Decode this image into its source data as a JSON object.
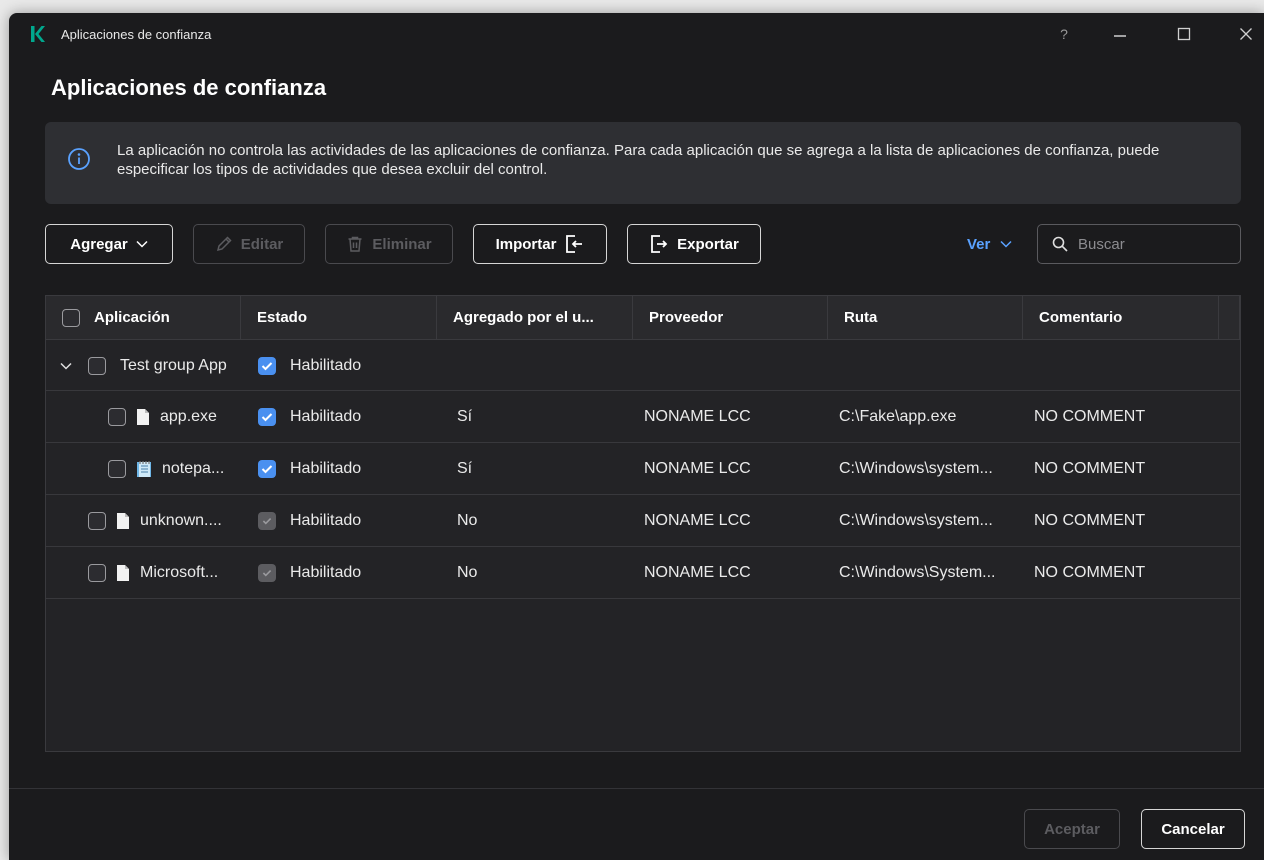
{
  "window": {
    "title": "Aplicaciones de confianza",
    "help": "?"
  },
  "page": {
    "title": "Aplicaciones de confianza"
  },
  "info": {
    "text": "La aplicación no controla las actividades de las aplicaciones de confianza. Para cada aplicación que se agrega a la lista de aplicaciones de confianza, puede especificar los tipos de actividades que desea excluir del control."
  },
  "toolbar": {
    "add_label": "Agregar",
    "edit_label": "Editar",
    "delete_label": "Eliminar",
    "import_label": "Importar",
    "export_label": "Exportar",
    "view_label": "Ver",
    "search_placeholder": "Buscar"
  },
  "table": {
    "columns": [
      "Aplicación",
      "Estado",
      "Agregado por el u...",
      "Proveedor",
      "Ruta",
      "Comentario"
    ],
    "rows": [
      {
        "name": "Test group App",
        "status": "Habilitado",
        "added": "",
        "vendor": "",
        "path": "",
        "comment": ""
      },
      {
        "name": "app.exe",
        "status": "Habilitado",
        "added": "Sí",
        "vendor": "NONAME LCC",
        "path": "C:\\Fake\\app.exe",
        "comment": "NO COMMENT"
      },
      {
        "name": "notepa...",
        "status": "Habilitado",
        "added": "Sí",
        "vendor": "NONAME LCC",
        "path": "C:\\Windows\\system...",
        "comment": "NO COMMENT"
      },
      {
        "name": "unknown....",
        "status": "Habilitado",
        "added": "No",
        "vendor": "NONAME LCC",
        "path": "C:\\Windows\\system...",
        "comment": "NO COMMENT"
      },
      {
        "name": "Microsoft...",
        "status": "Habilitado",
        "added": "No",
        "vendor": "NONAME LCC",
        "path": "C:\\Windows\\System...",
        "comment": "NO COMMENT"
      }
    ]
  },
  "footer": {
    "ok_label": "Aceptar",
    "cancel_label": "Cancelar"
  },
  "colors": {
    "accent": "#4a90f0",
    "link": "#5aa2ff",
    "logo": "#00a88e",
    "background": "#1b1b1d"
  }
}
